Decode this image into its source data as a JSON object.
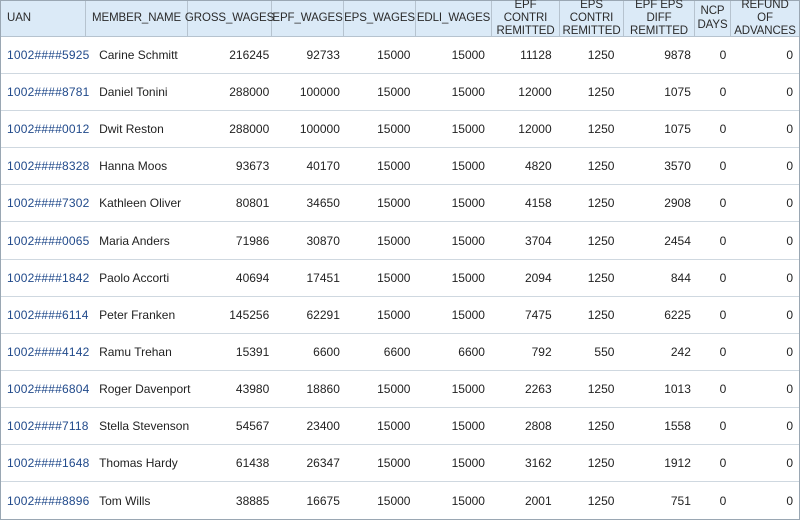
{
  "chart_data": {
    "type": "table",
    "columns": [
      "UAN",
      "MEMBER_NAME",
      "GROSS_WAGES",
      "EPF_WAGES",
      "EPS_WAGES",
      "EDLI_WAGES",
      "EPF CONTRI REMITTED",
      "EPS CONTRI REMITTED",
      "EPF EPS DIFF REMITTED",
      "NCP DAYS",
      "REFUND OF ADVANCES"
    ],
    "rows": [
      [
        "1002####5925",
        "Carine Schmitt",
        216245,
        92733,
        15000,
        15000,
        11128,
        1250,
        9878,
        0,
        0
      ],
      [
        "1002####8781",
        "Daniel Tonini",
        288000,
        100000,
        15000,
        15000,
        12000,
        1250,
        1075,
        0,
        0
      ],
      [
        "1002####0012",
        "Dwit Reston",
        288000,
        100000,
        15000,
        15000,
        12000,
        1250,
        1075,
        0,
        0
      ],
      [
        "1002####8328",
        "Hanna Moos",
        93673,
        40170,
        15000,
        15000,
        4820,
        1250,
        3570,
        0,
        0
      ],
      [
        "1002####7302",
        "Kathleen Oliver",
        80801,
        34650,
        15000,
        15000,
        4158,
        1250,
        2908,
        0,
        0
      ],
      [
        "1002####0065",
        "Maria Anders",
        71986,
        30870,
        15000,
        15000,
        3704,
        1250,
        2454,
        0,
        0
      ],
      [
        "1002####1842",
        "Paolo Accorti",
        40694,
        17451,
        15000,
        15000,
        2094,
        1250,
        844,
        0,
        0
      ],
      [
        "1002####6114",
        "Peter Franken",
        145256,
        62291,
        15000,
        15000,
        7475,
        1250,
        6225,
        0,
        0
      ],
      [
        "1002####4142",
        "Ramu Trehan",
        15391,
        6600,
        6600,
        6600,
        792,
        550,
        242,
        0,
        0
      ],
      [
        "1002####6804",
        "Roger Davenport",
        43980,
        18860,
        15000,
        15000,
        2263,
        1250,
        1013,
        0,
        0
      ],
      [
        "1002####7118",
        "Stella Stevenson",
        54567,
        23400,
        15000,
        15000,
        2808,
        1250,
        1558,
        0,
        0
      ],
      [
        "1002####1648",
        "Thomas Hardy",
        61438,
        26347,
        15000,
        15000,
        3162,
        1250,
        1912,
        0,
        0
      ],
      [
        "1002####8896",
        "Tom Wills",
        38885,
        16675,
        15000,
        15000,
        2001,
        1250,
        751,
        0,
        0
      ]
    ]
  },
  "headers": {
    "c0": "UAN",
    "c1": "MEMBER_NAME",
    "c2": "GROSS_WAGES",
    "c3": "EPF_WAGES",
    "c4": "EPS_WAGES",
    "c5": "EDLI_WAGES",
    "c6": "EPF CONTRI REMITTED",
    "c7": "EPS CONTRI REMITTED",
    "c8": "EPF EPS DIFF REMITTED",
    "c9": "NCP DAYS",
    "c10": "REFUND OF ADVANCES"
  }
}
